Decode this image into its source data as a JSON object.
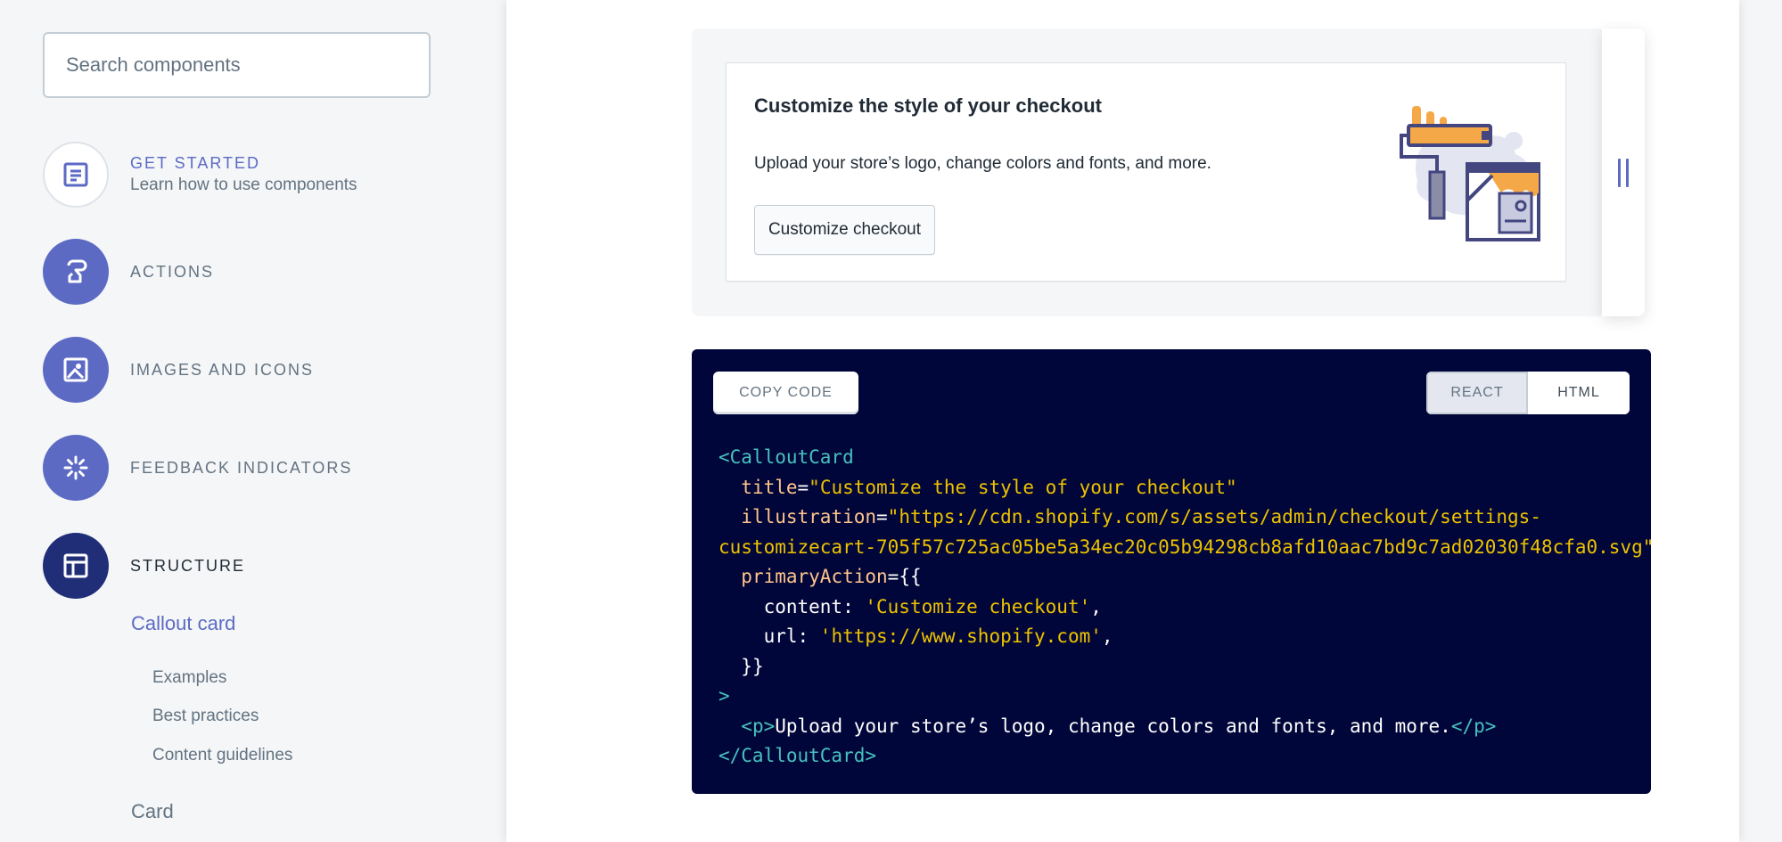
{
  "search": {
    "placeholder": "Search components"
  },
  "nav": {
    "get_started": {
      "label": "GET STARTED",
      "sub": "Learn how to use components"
    },
    "actions": {
      "label": "ACTIONS"
    },
    "images": {
      "label": "IMAGES AND ICONS"
    },
    "feedback": {
      "label": "FEEDBACK INDICATORS"
    },
    "structure": {
      "label": "STRUCTURE"
    }
  },
  "subnav": {
    "callout_card": "Callout card",
    "examples": "Examples",
    "best_practices": "Best practices",
    "content_guidelines": "Content guidelines",
    "card": "Card"
  },
  "preview": {
    "title": "Customize the style of your checkout",
    "body": "Upload your store’s logo, change colors and fonts, and more.",
    "button": "Customize checkout"
  },
  "code": {
    "copy": "COPY CODE",
    "tab_react": "REACT",
    "tab_html": "HTML",
    "l1_tag": "<CalloutCard",
    "l2_attr": "title",
    "l2_eq": "=",
    "l2_val": "\"Customize the style of your checkout\"",
    "l3_attr": "illustration",
    "l3_eq": "=",
    "l3_val": "\"https://cdn.shopify.com/s/assets/admin/checkout/settings-",
    "l4_val": "customizecart-705f57c725ac05be5a34ec20c05b94298cb8afd10aac7bd9c7ad02030f48cfa0.svg\"",
    "l5_attr": "primaryAction",
    "l5_rest": "={{",
    "l6_key": "content: ",
    "l6_val": "'Customize checkout'",
    "l6_end": ",",
    "l7_key": "url: ",
    "l7_val": "'https://www.shopify.com'",
    "l7_end": ",",
    "l8": "}}",
    "l9": ">",
    "l10_open": "<p>",
    "l10_text": "Upload your store’s logo, change colors and fonts, and more.",
    "l10_close": "</p>",
    "l11": "</CalloutCard>"
  },
  "colors": {
    "accent": "#5c6ac4",
    "accent_dark": "#202e78",
    "code_bg": "#000639",
    "code_tag": "#47c1bf",
    "code_string": "#eec200",
    "code_attr": "#ffc48b"
  },
  "icons": {
    "get_started": "document-icon",
    "actions": "pointer-icon",
    "images": "image-icon",
    "feedback": "spinner-icon",
    "structure": "layout-icon"
  }
}
